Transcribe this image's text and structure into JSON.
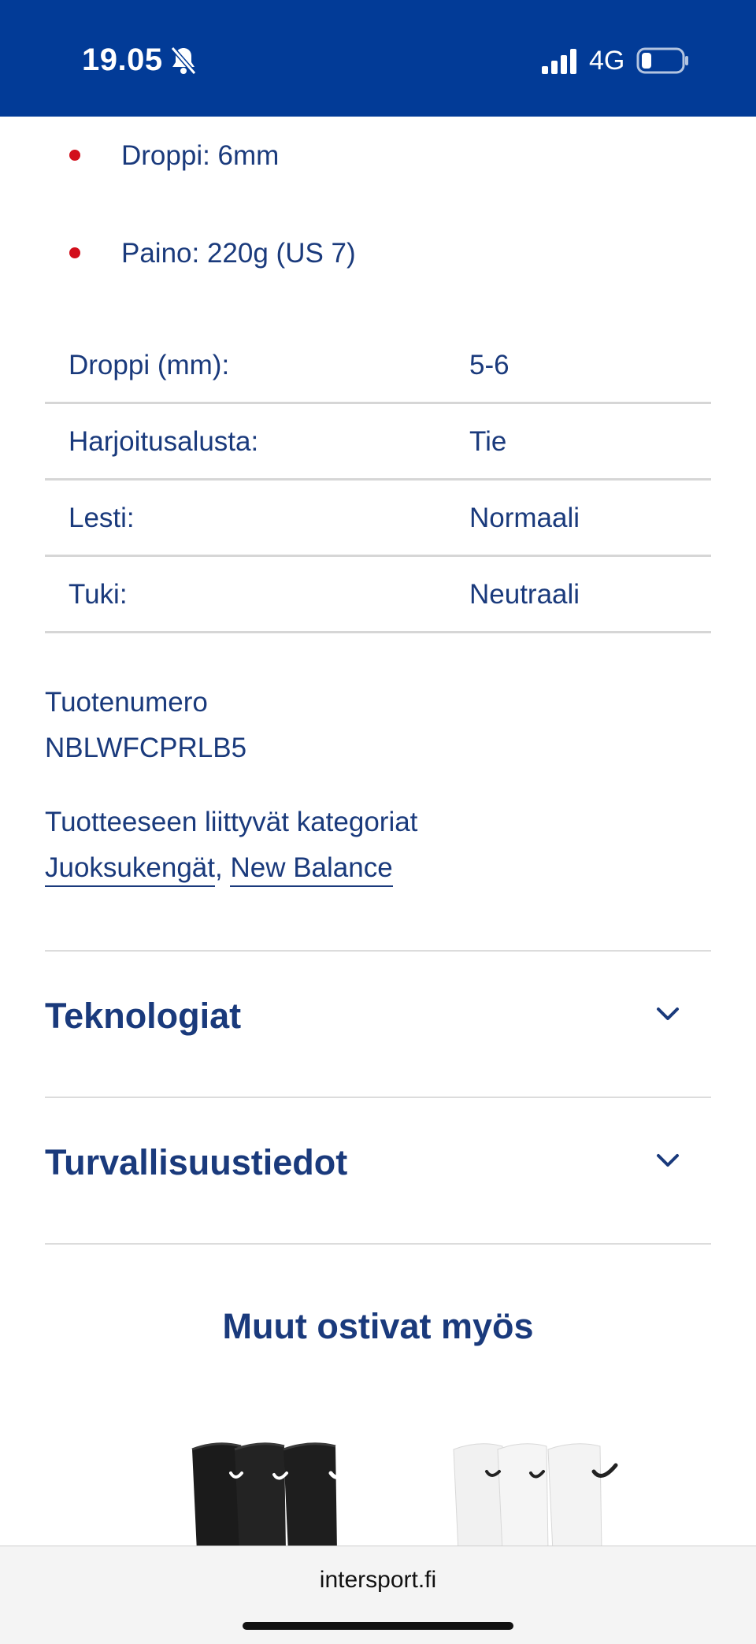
{
  "status_bar": {
    "time": "19.05",
    "network": "4G",
    "icons": [
      "bell-muted-icon",
      "signal-icon",
      "battery-icon"
    ],
    "background_color": "#023b97"
  },
  "bullets": [
    {
      "text": "Droppi: 6mm"
    },
    {
      "text": "Paino: 220g (US 7)"
    }
  ],
  "specs": [
    {
      "label": "Droppi (mm):",
      "value": "5-6"
    },
    {
      "label": "Harjoitusalusta:",
      "value": "Tie"
    },
    {
      "label": "Lesti:",
      "value": "Normaali"
    },
    {
      "label": "Tuki:",
      "value": "Neutraali"
    }
  ],
  "product_number": {
    "label": "Tuotenumero",
    "value": "NBLWFCPRLB5"
  },
  "categories": {
    "label": "Tuotteeseen liittyvät kategoriat",
    "links": [
      "Juoksukengät",
      "New Balance"
    ],
    "separator": ","
  },
  "accordions": [
    {
      "title": "Teknologiat",
      "icon": "chevron-down-icon"
    },
    {
      "title": "Turvallisuustiedot",
      "icon": "chevron-down-icon"
    }
  ],
  "recommendations": {
    "title": "Muut ostivat myös",
    "products": [
      {
        "image": "black-crew-socks-3-pack"
      },
      {
        "image": "white-crew-socks-3-pack"
      }
    ]
  },
  "browser": {
    "url": "intersport.fi"
  },
  "colors": {
    "primary_text": "#1a3a7c",
    "bullet": "#d20e1b",
    "header": "#023b97"
  }
}
